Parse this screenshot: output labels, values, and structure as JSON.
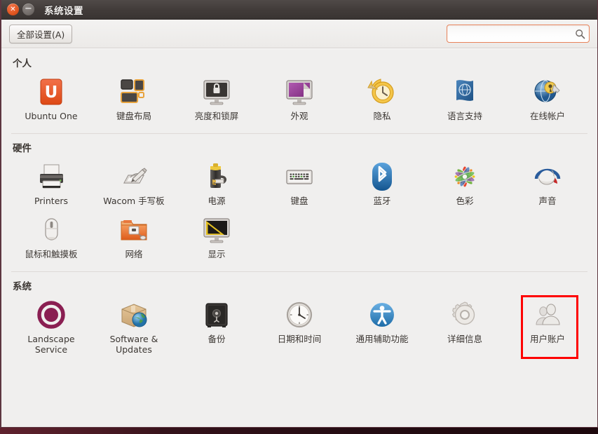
{
  "window": {
    "title": "系统设置",
    "close_glyph": "✕",
    "minimize_glyph": "−"
  },
  "toolbar": {
    "all_settings_label": "全部设置(A)",
    "search_value": "",
    "search_placeholder": "",
    "search_icon": "search-icon",
    "search_border_color": "#e8835a"
  },
  "highlight": {
    "color": "#fe0000",
    "target": "用户账户"
  },
  "sections": [
    {
      "title": "个人",
      "items": [
        {
          "label": "Ubuntu One",
          "icon": "ubuntu-one-icon"
        },
        {
          "label": "键盘布局",
          "icon": "keyboard-layout-icon"
        },
        {
          "label": "亮度和锁屏",
          "icon": "brightness-lock-icon"
        },
        {
          "label": "外观",
          "icon": "appearance-icon"
        },
        {
          "label": "隐私",
          "icon": "privacy-icon"
        },
        {
          "label": "语言支持",
          "icon": "language-support-icon"
        },
        {
          "label": "在线帐户",
          "icon": "online-accounts-icon"
        }
      ]
    },
    {
      "title": "硬件",
      "items": [
        {
          "label": "Printers",
          "icon": "printer-icon"
        },
        {
          "label": "Wacom 手写板",
          "icon": "wacom-tablet-icon"
        },
        {
          "label": "电源",
          "icon": "power-icon"
        },
        {
          "label": "键盘",
          "icon": "keyboard-icon"
        },
        {
          "label": "蓝牙",
          "icon": "bluetooth-icon"
        },
        {
          "label": "色彩",
          "icon": "color-icon"
        },
        {
          "label": "声音",
          "icon": "sound-icon"
        },
        {
          "label": "鼠标和触摸板",
          "icon": "mouse-touchpad-icon"
        },
        {
          "label": "网络",
          "icon": "network-icon"
        },
        {
          "label": "显示",
          "icon": "display-icon"
        }
      ]
    },
    {
      "title": "系统",
      "items": [
        {
          "label": "Landscape Service",
          "icon": "landscape-service-icon"
        },
        {
          "label": "Software & Updates",
          "icon": "software-updates-icon"
        },
        {
          "label": "备份",
          "icon": "backup-icon"
        },
        {
          "label": "日期和时间",
          "icon": "datetime-icon"
        },
        {
          "label": "通用辅助功能",
          "icon": "accessibility-icon"
        },
        {
          "label": "详细信息",
          "icon": "details-icon"
        },
        {
          "label": "用户账户",
          "icon": "user-accounts-icon",
          "highlighted": true
        }
      ]
    }
  ]
}
